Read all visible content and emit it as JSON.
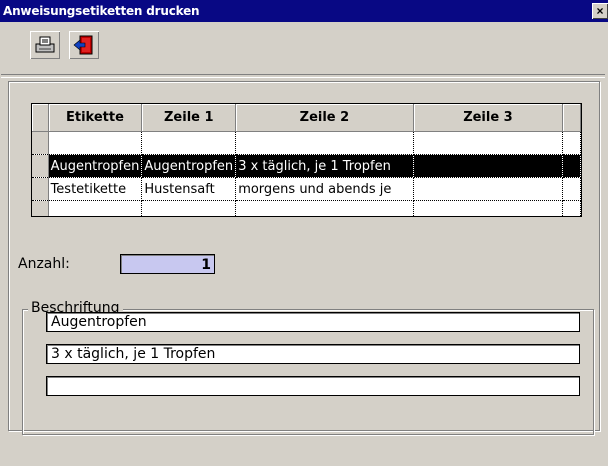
{
  "window": {
    "title": "Anweisungsetiketten drucken",
    "close_glyph": "×"
  },
  "toolbar": [
    {
      "name": "print-button",
      "icon": "printer-icon"
    },
    {
      "name": "exit-button",
      "icon": "exit-door-icon"
    }
  ],
  "grid": {
    "columns": [
      "Etikette",
      "Zeile 1",
      "Zeile 2",
      "Zeile 3"
    ],
    "rows": [
      [
        "",
        "",
        "",
        ""
      ],
      [
        "Augentropfen",
        "Augentropfen",
        "3 x täglich, je 1 Tropfen",
        ""
      ],
      [
        "Testetikette",
        "Hustensaft",
        "morgens und abends je",
        ""
      ],
      [
        "",
        "",
        "",
        ""
      ]
    ],
    "selected_row": 1
  },
  "anzahl": {
    "label": "Anzahl:",
    "value": "1"
  },
  "beschriftung": {
    "label": "Beschriftung",
    "lines": [
      "Augentropfen",
      "3 x täglich, je 1 Tropfen",
      ""
    ]
  }
}
